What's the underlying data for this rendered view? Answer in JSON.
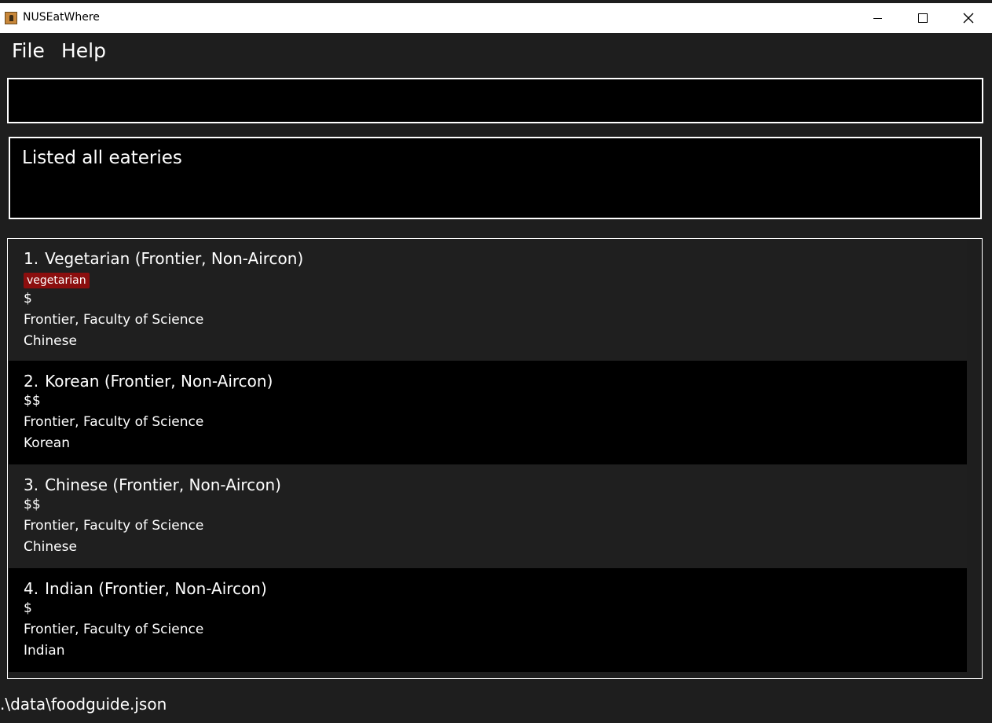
{
  "window": {
    "title": "NUSEatWhere"
  },
  "menu": {
    "file": "File",
    "help": "Help"
  },
  "command": {
    "value": "",
    "placeholder": ""
  },
  "result": {
    "text": "Listed all eateries"
  },
  "eateries": [
    {
      "index": "1.",
      "name": "Vegetarian (Frontier, Non-Aircon)",
      "tag": "vegetarian",
      "price": "$",
      "location": "Frontier, Faculty of Science",
      "cuisine": "Chinese"
    },
    {
      "index": "2.",
      "name": "Korean (Frontier, Non-Aircon)",
      "price": "$$",
      "location": "Frontier, Faculty of Science",
      "cuisine": "Korean"
    },
    {
      "index": "3.",
      "name": "Chinese (Frontier, Non-Aircon)",
      "price": "$$",
      "location": "Frontier, Faculty of Science",
      "cuisine": "Chinese"
    },
    {
      "index": "4.",
      "name": "Indian (Frontier, Non-Aircon)",
      "price": "$",
      "location": "Frontier, Faculty of Science",
      "cuisine": "Indian"
    }
  ],
  "status": {
    "file_path": ".\\data\\foodguide.json"
  },
  "colors": {
    "tag_background": "#8b0e0e",
    "background": "#1e1e1e",
    "titlebar": "#ffffff"
  }
}
